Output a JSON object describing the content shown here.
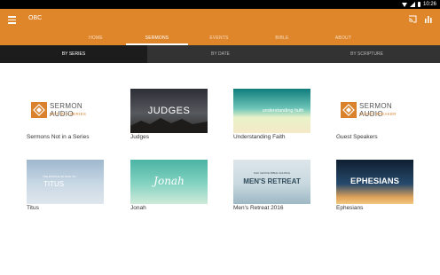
{
  "status_bar": {
    "time": "10:26"
  },
  "app_bar": {
    "title": "OBC",
    "icons": [
      "menu-icon",
      "cast-icon",
      "bar-chart-icon"
    ],
    "color": "#e0862a"
  },
  "tabs": [
    {
      "label": "HOME",
      "active": false
    },
    {
      "label": "SERMONS",
      "active": true
    },
    {
      "label": "EVENTS",
      "active": false
    },
    {
      "label": "BIBLE",
      "active": false
    },
    {
      "label": "ABOUT",
      "active": false
    }
  ],
  "subtabs": [
    {
      "label": "BY SERIES",
      "active": true
    },
    {
      "label": "BY DATE",
      "active": false
    },
    {
      "label": "BY SCRIPTURE",
      "active": false
    }
  ],
  "series": [
    {
      "label": "Sermons Not in a Series",
      "art_title": "SERMON AUDIO",
      "art_subtitle": "NOT IN A SERIES"
    },
    {
      "label": "Judges",
      "art_title": "JUDGES"
    },
    {
      "label": "Understanding Faith",
      "art_title": "understanding faith"
    },
    {
      "label": "Guest Speakers",
      "art_title": "SERMON AUDIO",
      "art_subtitle": "GUEST SPEAKER"
    },
    {
      "label": "Titus",
      "art_title": "TITUS",
      "art_subtitle": "THE EPISTLE OF PAUL TO"
    },
    {
      "label": "Jonah",
      "art_title": "Jonah"
    },
    {
      "label": "Men's Retreat 2016",
      "art_title": "MEN'S RETREAT",
      "art_subtitle": "OAK GROVE BIBLE CHURCH"
    },
    {
      "label": "Ephesians",
      "art_title": "EPHESIANS"
    }
  ]
}
